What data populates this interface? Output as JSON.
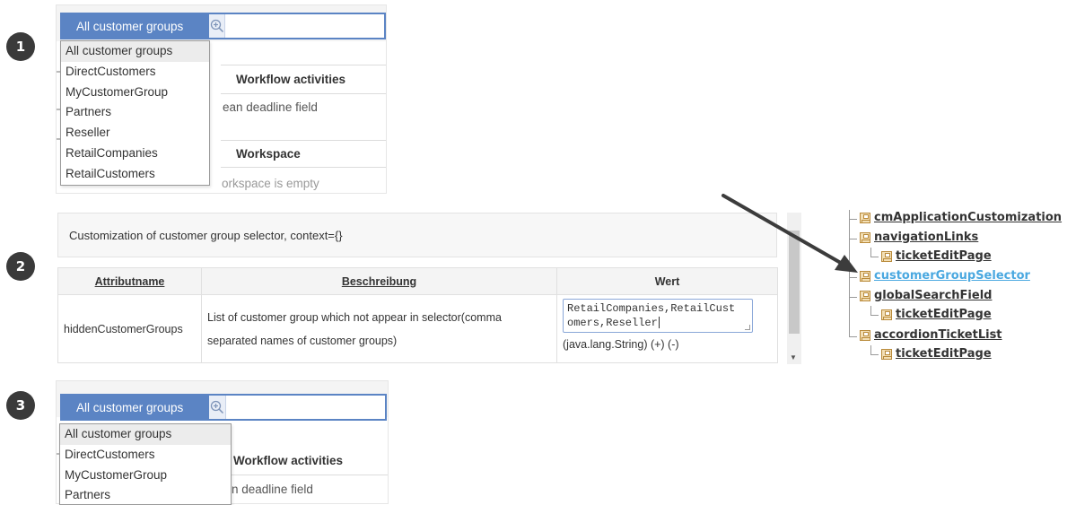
{
  "steps": [
    "1",
    "2",
    "3"
  ],
  "panel1": {
    "customer_group_button": "All customer groups",
    "search_placeholder": "",
    "dropdown_options": [
      "All customer groups",
      "DirectCustomers",
      "MyCustomerGroup",
      "Partners",
      "Reseller",
      "RetailCompanies",
      "RetailCustomers"
    ],
    "background": {
      "workflow_heading": "Workflow activities",
      "deadline_text": "ean deadline field",
      "workspace_heading": "Workspace",
      "workspace_empty": "orkspace is empty"
    }
  },
  "panel2": {
    "header": "Customization of customer group selector, context={}",
    "columns": [
      "Attributname",
      "Beschreibung",
      "Wert"
    ],
    "row": {
      "name": "hiddenCustomerGroups",
      "description": "List of customer group which not appear in selector(comma separated names of customer groups)",
      "value_line1": "RetailCompanies,RetailCust",
      "value_line2": "omers,Reseller",
      "value_type": "(java.lang.String) (+) (-)"
    }
  },
  "tree": {
    "items": [
      {
        "label": "cmApplicationCustomization",
        "level": 0
      },
      {
        "label": "navigationLinks",
        "level": 0
      },
      {
        "label": "ticketEditPage",
        "level": 1
      },
      {
        "label": "customerGroupSelector",
        "level": 0,
        "highlighted": true
      },
      {
        "label": "globalSearchField",
        "level": 0
      },
      {
        "label": "ticketEditPage",
        "level": 1
      },
      {
        "label": "accordionTicketList",
        "level": 0
      },
      {
        "label": "ticketEditPage",
        "level": 1
      }
    ]
  },
  "panel3": {
    "customer_group_button": "All customer groups",
    "search_placeholder": "",
    "dropdown_options": [
      "All customer groups",
      "DirectCustomers",
      "MyCustomerGroup",
      "Partners"
    ],
    "background": {
      "workflow_heading": "Workflow activities",
      "deadline_text": "ean deadline field"
    }
  },
  "colors": {
    "accent": "#5b84c4",
    "highlight_link": "#4aa8e0",
    "badge": "#3a3a3a"
  }
}
